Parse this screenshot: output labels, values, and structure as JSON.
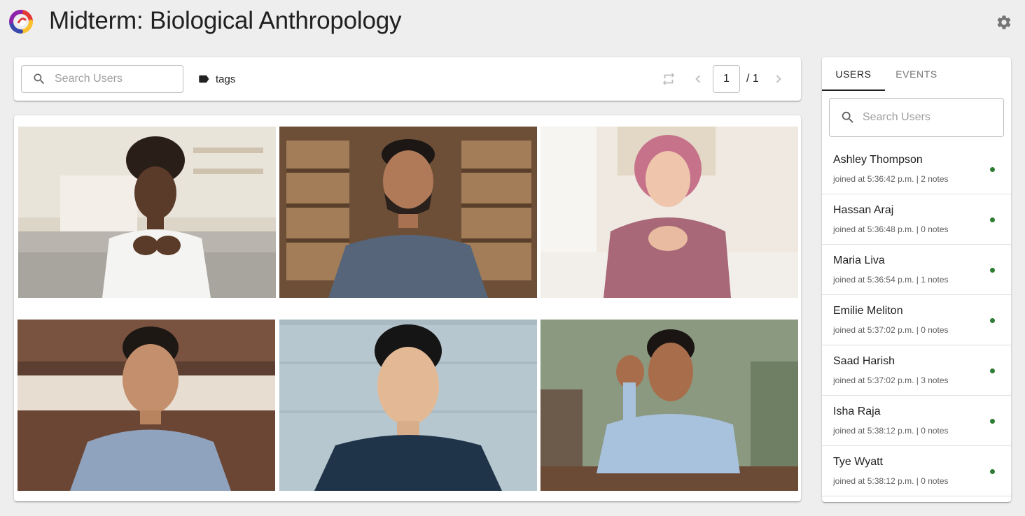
{
  "app": {
    "title": "Midterm: Biological Anthropology",
    "logo_icon": "spiral-logo-icon",
    "settings_icon": "gear-icon"
  },
  "toolbar": {
    "search_placeholder": "Search Users",
    "tags_label": "tags",
    "page_current": "1",
    "page_total": "/  1"
  },
  "participants": [
    {
      "tile": "participant-video-1",
      "bg": "#d9d2c6"
    },
    {
      "tile": "participant-video-2",
      "bg": "#7a5a3e"
    },
    {
      "tile": "participant-video-3",
      "bg": "#ece6df"
    },
    {
      "tile": "participant-video-4",
      "bg": "#5a3e30"
    },
    {
      "tile": "participant-video-5",
      "bg": "#b4c4cc"
    },
    {
      "tile": "participant-video-6",
      "bg": "#7e8d74"
    }
  ],
  "sidebar": {
    "tabs": [
      "USERS",
      "EVENTS"
    ],
    "search_placeholder": "Search Users",
    "online_color": "#2e7d32",
    "users": [
      {
        "name": "Ashley Thompson",
        "meta": "joined at 5:36:42 p.m.  |  2 notes"
      },
      {
        "name": "Hassan Araj",
        "meta": "joined at 5:36:48 p.m.  |  0 notes"
      },
      {
        "name": "Maria Liva",
        "meta": "joined at 5:36:54 p.m.  |  1 notes"
      },
      {
        "name": "Emilie Meliton",
        "meta": "joined at 5:37:02 p.m.  |  0 notes"
      },
      {
        "name": "Saad Harish",
        "meta": "joined at 5:37:02 p.m.  |  3 notes"
      },
      {
        "name": "Isha Raja",
        "meta": "joined at 5:38:12 p.m.  |  0 notes"
      },
      {
        "name": "Tye Wyatt",
        "meta": "joined at 5:38:12 p.m.  |  0 notes"
      }
    ]
  }
}
